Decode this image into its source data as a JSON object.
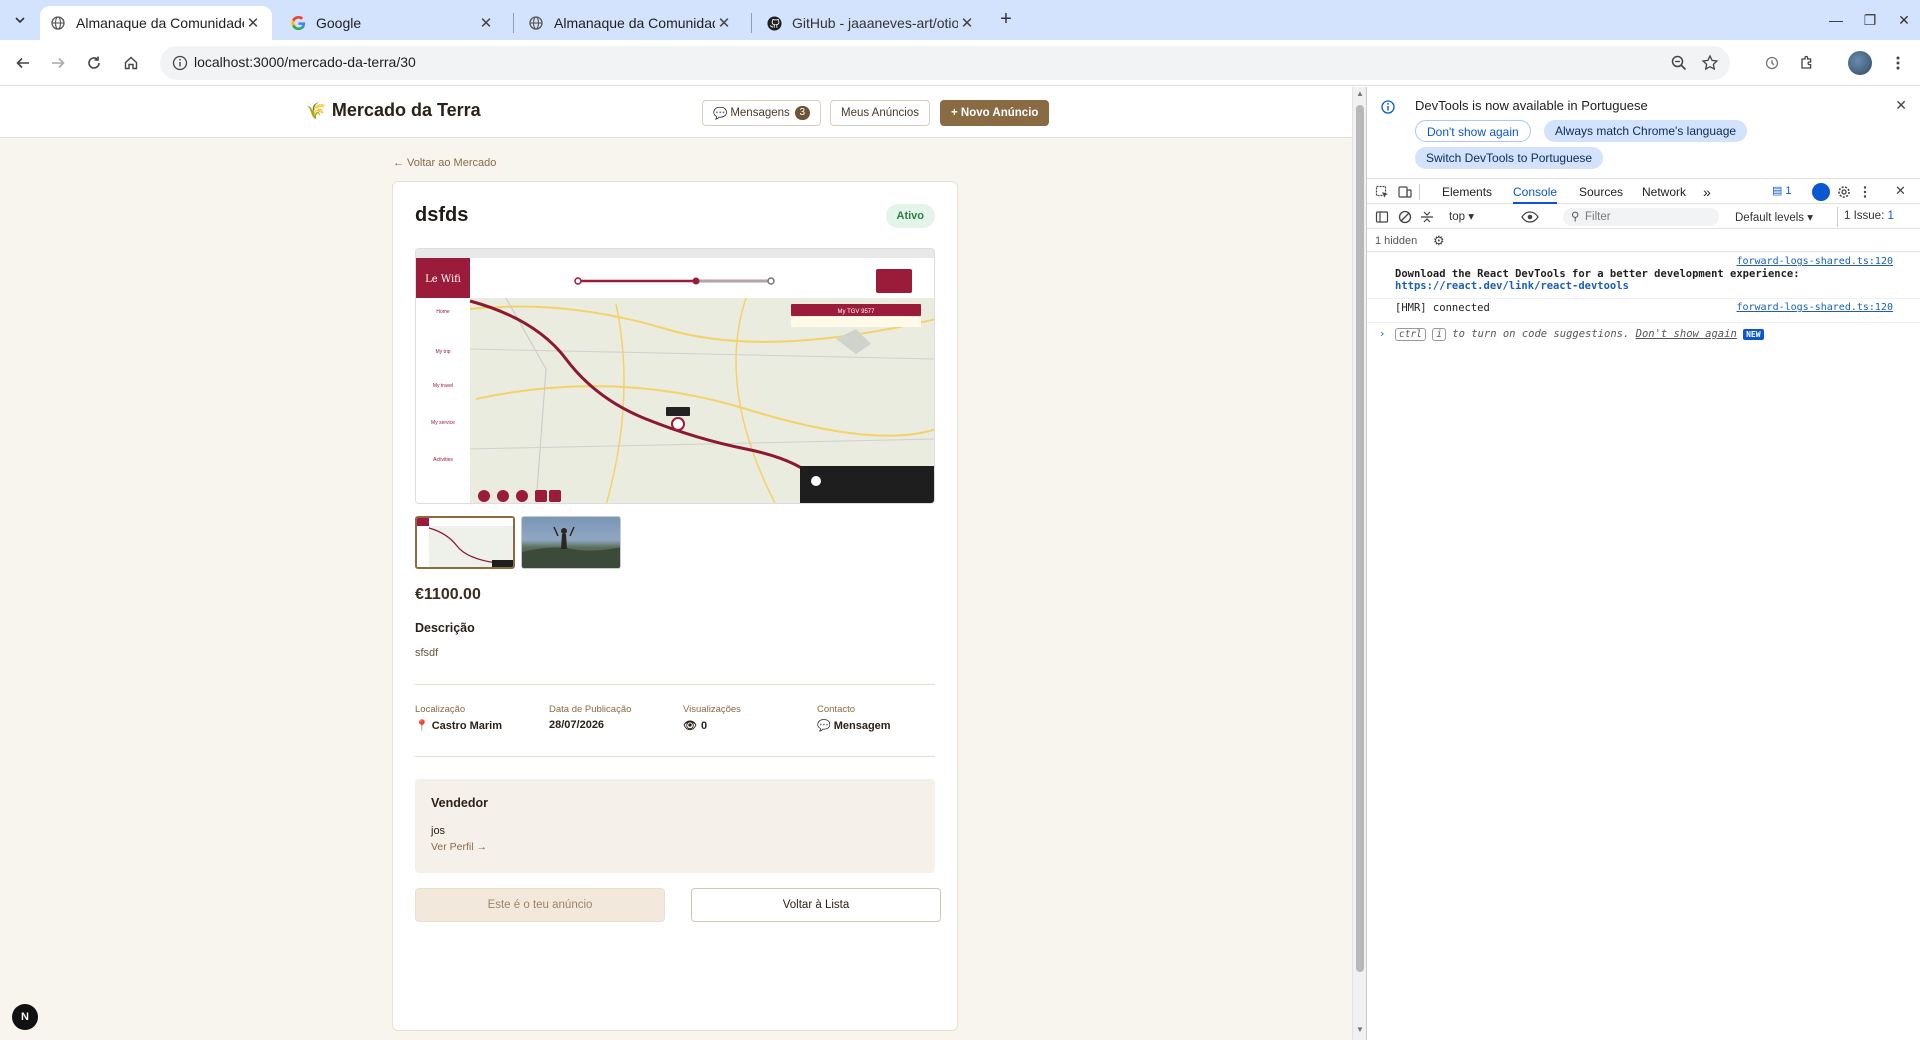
{
  "browser": {
    "tabs": [
      {
        "title": "Almanaque da Comunidade",
        "active": true
      },
      {
        "title": "Google",
        "active": false
      },
      {
        "title": "Almanaque da Comunidade",
        "active": false
      },
      {
        "title": "GitHub - jaaaneves-art/otiod",
        "active": false
      }
    ],
    "new_tab": "+",
    "url": "localhost:3000/mercado-da-terra/30"
  },
  "app": {
    "brand": "Mercado da Terra",
    "brand_icon": "🌾",
    "header": {
      "messages_label": "Mensagens",
      "messages_count": "3",
      "my_ads_label": "Meus Anúncios",
      "new_ad_label": "+ Novo Anúncio"
    },
    "back_link": "← Voltar ao Mercado",
    "listing": {
      "title": "dsfds",
      "status": "Ativo",
      "price": "€1100.00",
      "description_heading": "Descrição",
      "description": "sfsdf",
      "meta": [
        {
          "label": "Localização",
          "icon": "📍",
          "value": "Castro Marim"
        },
        {
          "label": "Data de Publicação",
          "icon": "",
          "value": "28/07/2026"
        },
        {
          "label": "Visualizações",
          "icon": "👁",
          "value": "0"
        },
        {
          "label": "Contacto",
          "icon": "💬",
          "value": "Mensagem"
        }
      ],
      "seller": {
        "heading": "Vendedor",
        "name": "jos",
        "profile_link": "Ver Perfil →"
      },
      "own_ad_button": "Este é o teu anúncio",
      "back_to_list_button": "Voltar à Lista"
    },
    "next_badge": "N"
  },
  "screenshot_map": {
    "brand": "Le Wifi",
    "train": "My TGV 9577",
    "sidebar": [
      "Home",
      "My trip",
      "My travel",
      "My service",
      "Activities"
    ]
  },
  "devtools": {
    "notice": "DevTools is now available in Portuguese",
    "dont_show_again": "Don't show again",
    "always_match": "Always match Chrome's language",
    "switch_pt": "Switch DevTools to Portuguese",
    "tabs": [
      "Elements",
      "Console",
      "Sources",
      "Network"
    ],
    "active_tab": "Console",
    "more_tabs": "»",
    "issues_count": "1",
    "context": "top",
    "filter_placeholder": "Filter",
    "levels": "Default levels",
    "issue_label": "1 Issue:",
    "issue_count_small": "1",
    "hidden_count": "1 hidden",
    "logs": [
      {
        "source": "forward-logs-shared.ts:120",
        "text": "Download the React DevTools for a better development experience:",
        "link": "https://react.dev/link/react-devtools"
      },
      {
        "source": "forward-logs-shared.ts:120",
        "text": "[HMR] connected"
      }
    ],
    "suggestion": {
      "key1": "ctrl",
      "key2": "i",
      "text": "to turn on code suggestions.",
      "dismiss": "Don't show again",
      "tag": "NEW"
    }
  }
}
